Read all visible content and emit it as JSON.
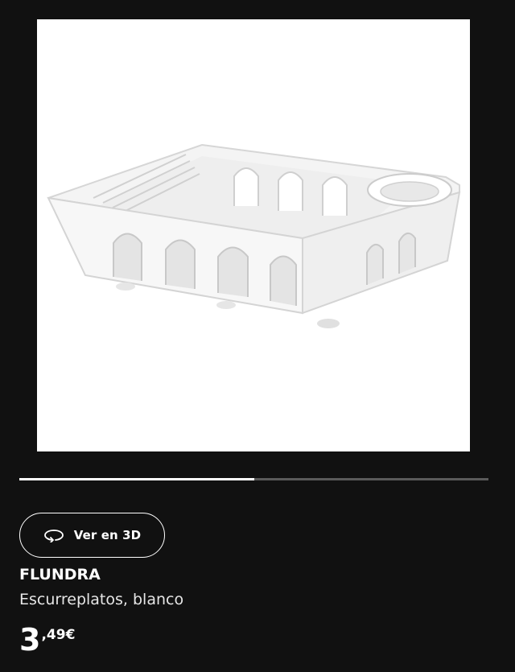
{
  "gallery": {
    "image_icon": "dish-drainer-image",
    "progress": 0.5
  },
  "actions": {
    "view_3d_label": "Ver en 3D",
    "view_3d_icon": "rotate-3d-icon"
  },
  "product": {
    "name": "FLUNDRA",
    "description": "Escurreplatos, blanco",
    "price_integer": "3",
    "price_decimal": ",49€"
  },
  "colors": {
    "background": "#111111",
    "text": "#ffffff",
    "progress_track": "#5a5a5a",
    "progress_fill": "#ffffff"
  }
}
